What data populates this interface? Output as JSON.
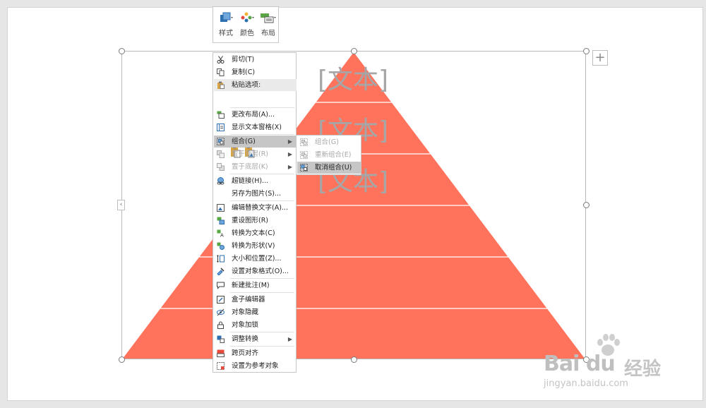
{
  "toolbar": {
    "style_label": "样式",
    "color_label": "颜色",
    "layout_label": "布局"
  },
  "slide": {
    "placeholders": [
      "[文本]",
      "[文本]",
      "[文本]"
    ],
    "fill_color": "#ff735d"
  },
  "context_menu": {
    "cut": "剪切(T)",
    "copy": "复制(C)",
    "paste_header": "粘贴选项:",
    "change_layout": "更改布局(A)...",
    "show_text_pane": "显示文本窗格(X)",
    "group": "组合(G)",
    "bring_to_front": "置于顶层(R)",
    "send_to_back": "置于底层(K)",
    "hyperlink": "超链接(H)...",
    "save_as_picture": "另存为图片(S)...",
    "edit_alt_text": "编辑替换文字(A)...",
    "reset_graphic": "重设图形(R)",
    "convert_to_text": "转换为文本(C)",
    "convert_to_shapes": "转换为形状(V)",
    "size_position": "大小和位置(Z)...",
    "format_object": "设置对象格式(O)...",
    "new_comment": "新建批注(M)",
    "box_editor": "盒子编辑器",
    "hide_object": "对象隐藏",
    "lock_object": "对象加锁",
    "adjust_convert": "调整转换",
    "cross_page_align": "跨页对齐",
    "set_reference": "设置为参考对象"
  },
  "submenu": {
    "group": "组合(G)",
    "regroup": "重新组合(E)",
    "ungroup": "取消组合(U)"
  },
  "watermark": {
    "logo": "Bai du",
    "cn": "经验",
    "url": "jingyan.baidu.com"
  }
}
